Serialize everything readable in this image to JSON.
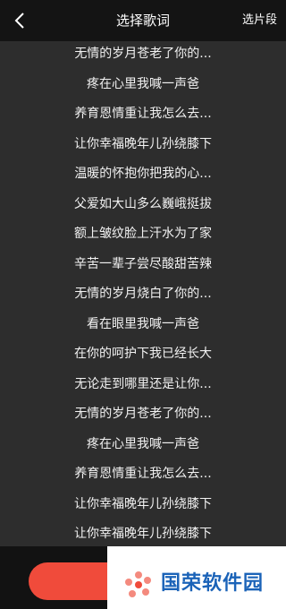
{
  "header": {
    "title": "选择歌词",
    "select_segment": "选片段",
    "back_icon": "chevron-left-icon"
  },
  "lyrics": [
    "无情的岁月苍老了你的...",
    "疼在心里我喊一声爸",
    "养育恩情重让我怎么去...",
    "让你幸福晚年儿孙绕膝下",
    "温暖的怀抱你把我的心...",
    "父爱如大山多么巍峨挺拔",
    "额上皱纹脸上汗水为了家",
    "辛苦一辈子尝尽酸甜苦辣",
    "无情的岁月烧白了你的...",
    "看在眼里我喊一声爸",
    "在你的呵护下我已经长大",
    "无论走到哪里还是让你...",
    "无情的岁月苍老了你的...",
    "疼在心里我喊一声爸",
    "养育恩情重让我怎么去...",
    "让你幸福晚年儿孙绕膝下",
    "让你幸福晚年儿孙绕膝下"
  ],
  "footer": {
    "watermark_text": "国荣软件园"
  },
  "colors": {
    "accent": "#f04b3b",
    "watermark": "#1b63b8",
    "header_bg": "#141414",
    "list_bg": "#2d2d2d"
  }
}
